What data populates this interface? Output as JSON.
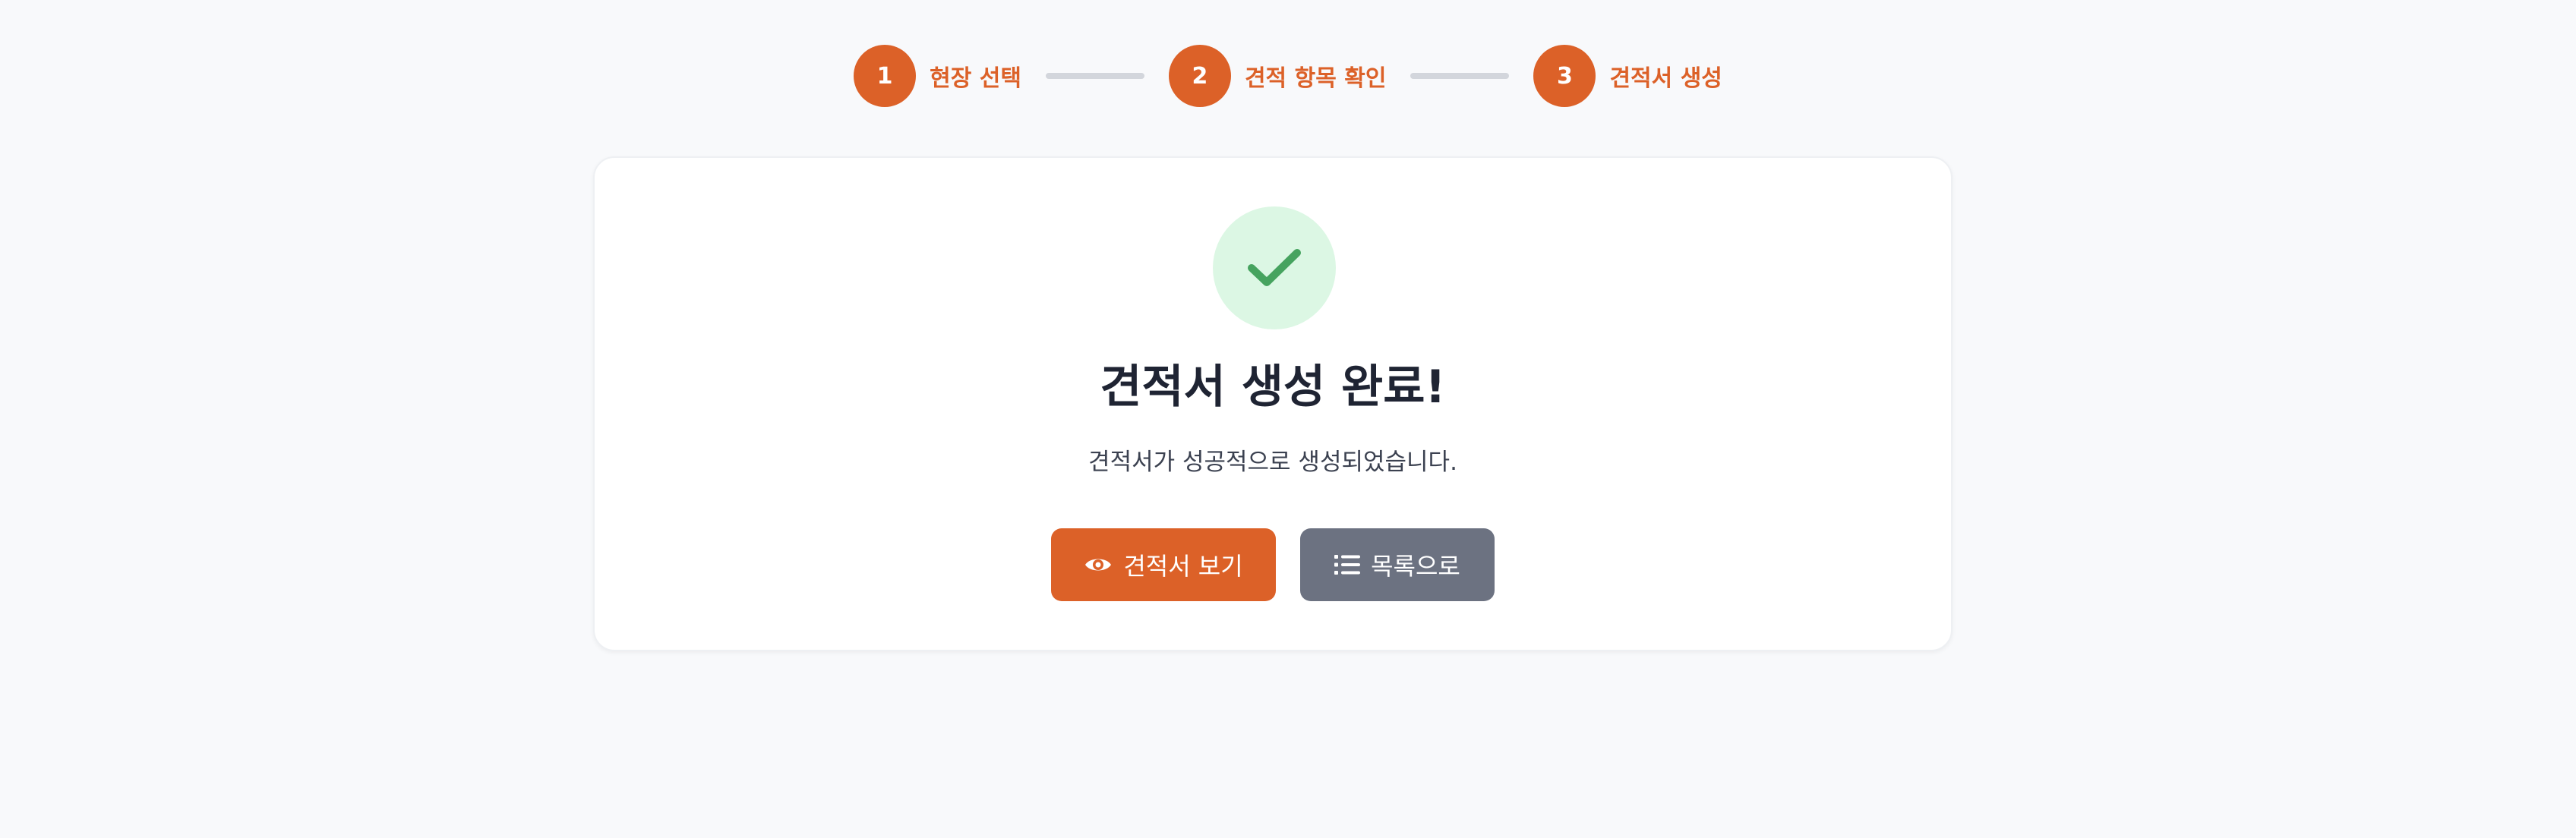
{
  "stepper": {
    "steps": [
      {
        "number": "1",
        "label": "현장 선택"
      },
      {
        "number": "2",
        "label": "견적 항목 확인"
      },
      {
        "number": "3",
        "label": "견적서 생성"
      }
    ],
    "active_color": "#dc6128"
  },
  "result": {
    "icon": "check-icon",
    "title": "견적서 생성 완료!",
    "message": "견적서가 성공적으로 생성되었습니다."
  },
  "actions": {
    "view": {
      "label": "견적서 보기",
      "icon": "eye-icon",
      "color": "#dc6128"
    },
    "list": {
      "label": "목록으로",
      "icon": "list-icon",
      "color": "#6c7281"
    }
  }
}
